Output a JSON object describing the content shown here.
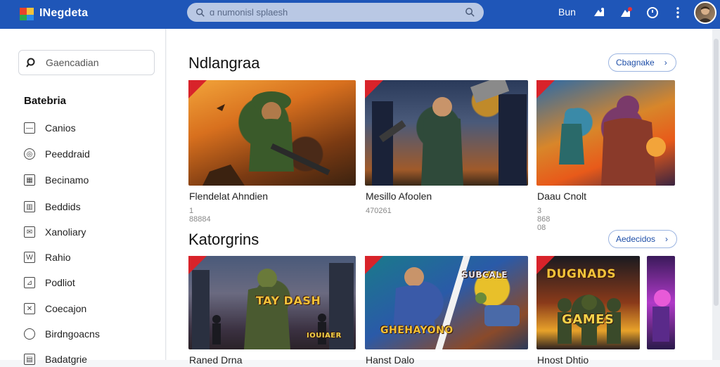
{
  "header": {
    "brand": "INegdeta",
    "search_placeholder": "ɑ numonisl splaesh",
    "user_button": "Bun",
    "colors": {
      "bar": "#1f56b8",
      "accent": "#d8232a"
    }
  },
  "sidebar": {
    "search_placeholder": "Gaencadian",
    "heading": "Batebria",
    "items": [
      {
        "label": "Canios",
        "icon": "tag-icon"
      },
      {
        "label": "Peeddraid",
        "icon": "globe-icon"
      },
      {
        "label": "Becinamo",
        "icon": "grid-icon"
      },
      {
        "label": "Beddids",
        "icon": "chart-icon"
      },
      {
        "label": "Xanoliary",
        "icon": "envelope-icon"
      },
      {
        "label": "Rahio",
        "icon": "radio-icon"
      },
      {
        "label": "Podliot",
        "icon": "flag-icon"
      },
      {
        "label": "Coecajon",
        "icon": "calendar-icon"
      },
      {
        "label": "Birdngoacns",
        "icon": "circle-icon"
      },
      {
        "label": "Badatgrie",
        "icon": "folder-icon"
      }
    ]
  },
  "sections": [
    {
      "title": "Ndlangraa",
      "see_more": "Cbagnake",
      "cards": [
        {
          "title": "Flendelat Ahndien",
          "meta": "1 88884",
          "art_text": ""
        },
        {
          "title": "Mesillo Afoolen",
          "meta": "470261",
          "art_text": ""
        },
        {
          "title": "Daau Cnolt",
          "meta": "3 868 08",
          "art_text": ""
        }
      ]
    },
    {
      "title": "Katorgrins",
      "see_more": "Aedecidos",
      "cards": [
        {
          "title": "Raned Drna",
          "meta": "",
          "art_text": "TAY DASH",
          "art_sub": "IOUIAER"
        },
        {
          "title": "Hanst Dalo",
          "meta": "",
          "art_text": "GHEHAYONO",
          "art_sub": "SUBCALE"
        },
        {
          "title": "Hnost Dhtio",
          "meta": "",
          "art_text": "DUGNADS",
          "art_sub": "GAMES"
        },
        {
          "title": "",
          "meta": "",
          "art_text": ""
        }
      ]
    }
  ]
}
